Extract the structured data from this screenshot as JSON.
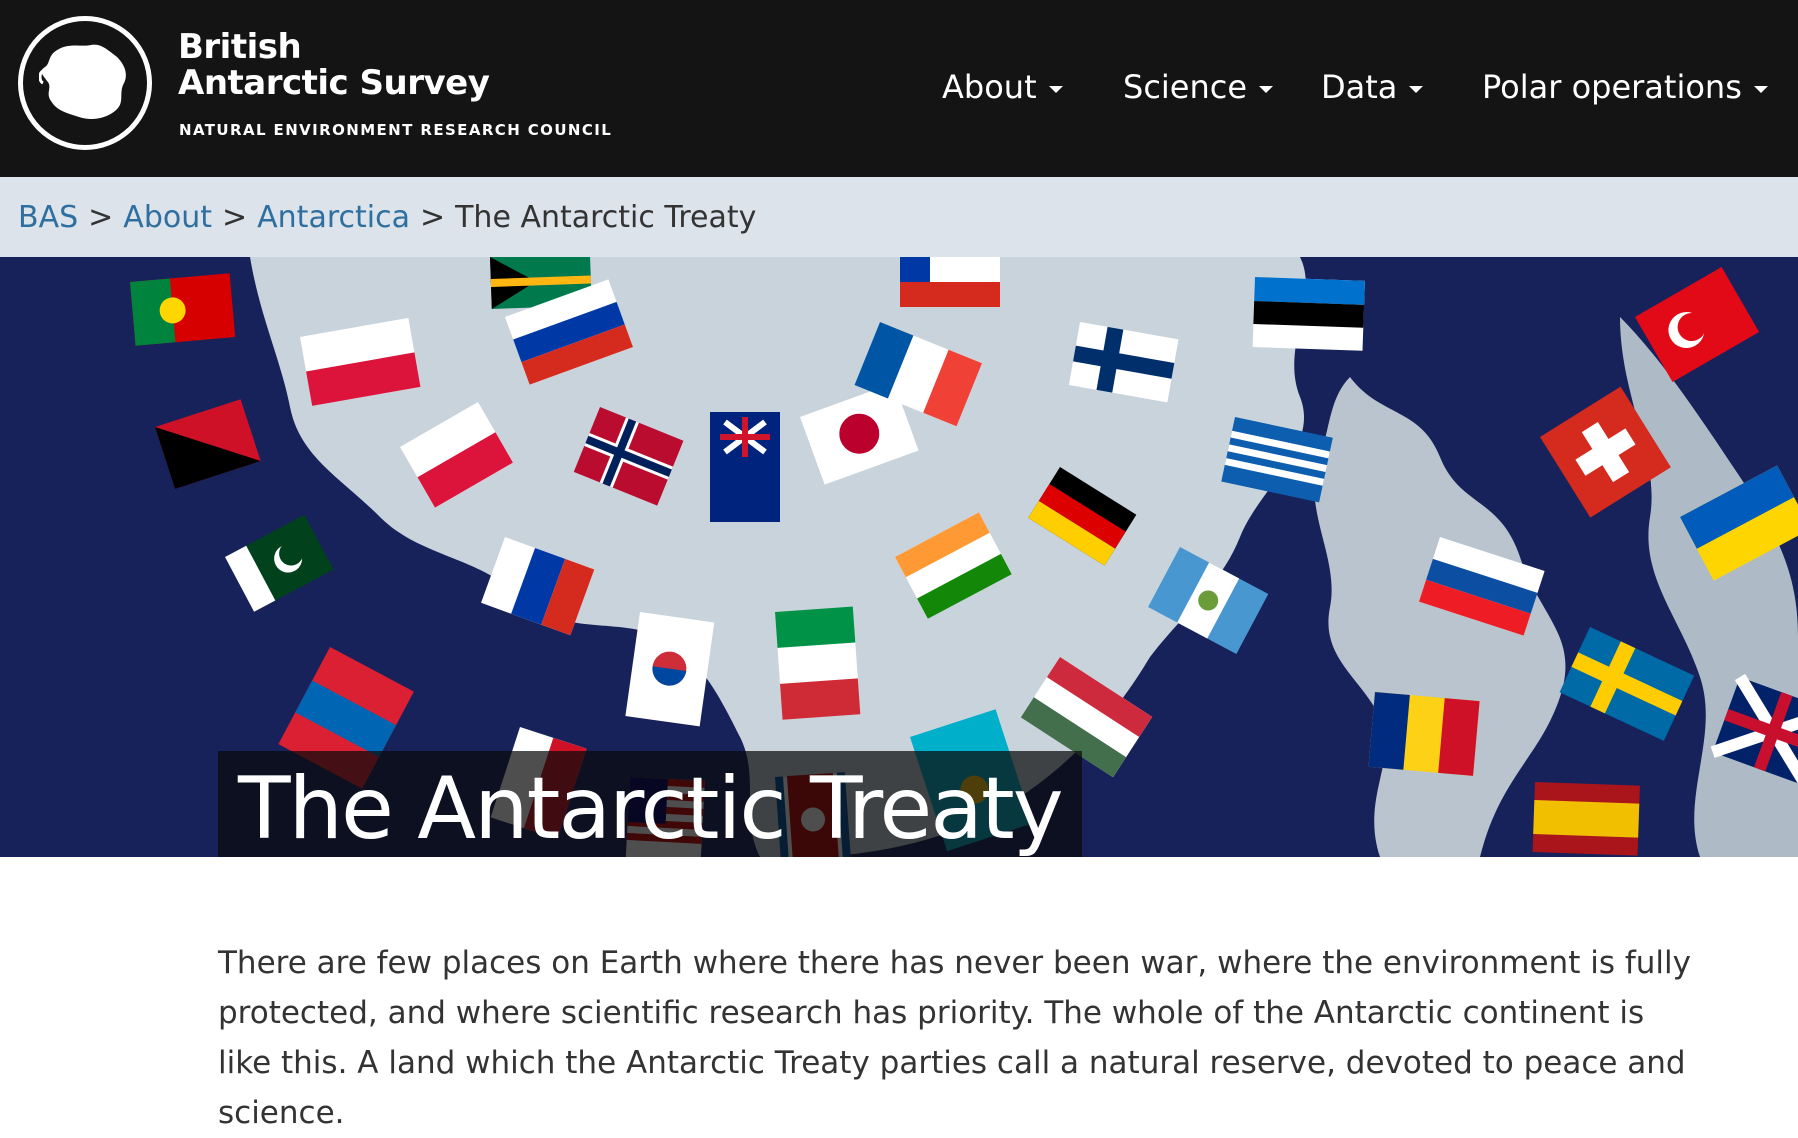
{
  "brand": {
    "line1": "British",
    "line2": "Antarctic Survey",
    "subtitle": "NATURAL ENVIRONMENT RESEARCH COUNCIL"
  },
  "nav": {
    "items": [
      {
        "label": "About"
      },
      {
        "label": "Science"
      },
      {
        "label": "Data"
      },
      {
        "label": "Polar operations"
      }
    ]
  },
  "breadcrumb": {
    "items": [
      {
        "label": "BAS"
      },
      {
        "label": "About"
      },
      {
        "label": "Antarctica"
      }
    ],
    "current": "The Antarctic Treaty",
    "separator": ">"
  },
  "hero": {
    "title": "The Antarctic Treaty"
  },
  "content": {
    "intro": "There are few places on Earth where there has never been war, where the environment is fully protected, and where scientific research has priority. The whole of the Antarctic continent is like this. A land which the Antarctic Treaty parties call a natural reserve, devoted to peace and science."
  },
  "colors": {
    "header_bg": "#141414",
    "breadcrumb_bg": "#dce3ea",
    "link": "#2f6fa0",
    "hero_ocean": "#17215a"
  }
}
